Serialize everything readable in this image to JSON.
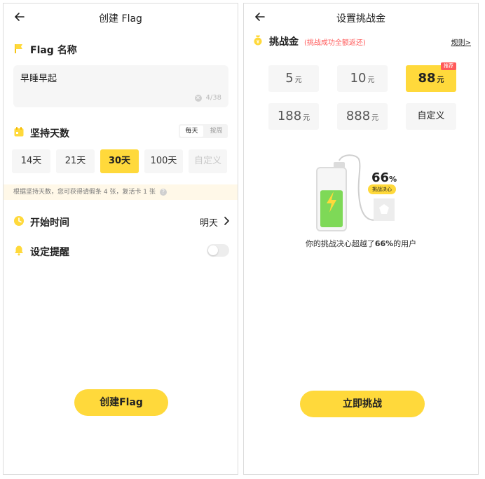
{
  "left": {
    "header": {
      "title": "创建 Flag"
    },
    "name_section": {
      "label": "Flag 名称",
      "input_value": "早睡早起",
      "counter": "4/38"
    },
    "days_section": {
      "label": "坚持天数",
      "mode_toggle": [
        {
          "label": "每天",
          "active": true
        },
        {
          "label": "按周",
          "active": false
        }
      ],
      "options": [
        {
          "label": "14天",
          "active": false
        },
        {
          "label": "21天",
          "active": false
        },
        {
          "label": "30天",
          "active": true
        },
        {
          "label": "100天",
          "active": false
        },
        {
          "label": "自定义",
          "active": false
        }
      ],
      "hint": "根据坚持天数，您可获得请假条 4 张，复活卡 1 张"
    },
    "start_time": {
      "label": "开始时间",
      "value": "明天"
    },
    "reminder": {
      "label": "设定提醒",
      "enabled": false
    },
    "cta": {
      "label": "创建Flag"
    }
  },
  "right": {
    "header": {
      "title": "设置挑战金"
    },
    "section": {
      "label": "挑战金",
      "subtitle": "(挑战成功全额返还)",
      "rules_link": "规则>"
    },
    "amounts": [
      {
        "num": "5",
        "unit": "元",
        "active": false
      },
      {
        "num": "10",
        "unit": "元",
        "active": false
      },
      {
        "num": "88",
        "unit": "元",
        "active": true,
        "badge": "推荐"
      },
      {
        "num": "188",
        "unit": "元",
        "active": false
      },
      {
        "num": "888",
        "unit": "元",
        "active": false
      },
      {
        "num": "自定义",
        "unit": "",
        "active": false
      }
    ],
    "resolve": {
      "percent": "66",
      "percent_sign": "%",
      "tag": "挑战决心",
      "level_fraction": 0.66
    },
    "beat_text_prefix": "你的挑战决心超越了",
    "beat_value": "66%",
    "beat_text_suffix": "的用户",
    "cta": {
      "label": "立即挑战"
    }
  },
  "colors": {
    "accent": "#ffd93b",
    "battery_green": "#7ed957",
    "bolt": "#ffd93b",
    "red": "#ff5a5a",
    "hint_bg": "#fff8e8"
  },
  "icons": [
    "back-arrow-icon",
    "flag-icon",
    "calendar-icon",
    "clock-icon",
    "bell-icon",
    "chevron-right-icon",
    "coin-icon",
    "battery-icon",
    "lightning-icon",
    "plug-icon",
    "clear-icon",
    "help-icon"
  ]
}
